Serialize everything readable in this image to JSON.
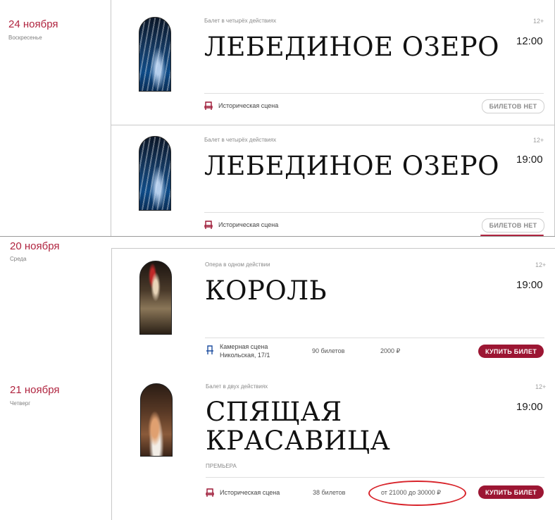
{
  "dates": [
    {
      "date": "24 ноября",
      "weekday": "Воскресенье"
    },
    {
      "date": "20 ноября",
      "weekday": "Среда"
    },
    {
      "date": "21 ноября",
      "weekday": "Четверг"
    }
  ],
  "events": [
    {
      "genre": "Балет в четырёх действиях",
      "age": "12+",
      "title": "ЛЕБЕДИНОЕ ОЗЕРО",
      "time": "12:00",
      "venue": "Историческая сцена",
      "button": "БИЛЕТОВ НЕТ"
    },
    {
      "genre": "Балет в четырёх действиях",
      "age": "12+",
      "title": "ЛЕБЕДИНОЕ ОЗЕРО",
      "time": "19:00",
      "venue": "Историческая сцена",
      "button": "БИЛЕТОВ НЕТ"
    },
    {
      "genre": "Опера в одном действии",
      "age": "12+",
      "title": "КОРОЛЬ",
      "time": "19:00",
      "venue": "Камерная сцена",
      "venue_address": "Никольская, 17/1",
      "tickets": "90 билетов",
      "price": "2000 ₽",
      "button": "КУПИТЬ БИЛЕТ"
    },
    {
      "genre": "Балет в двух действиях",
      "age": "12+",
      "title_line1": "СПЯЩАЯ",
      "title_line2": "КРАСАВИЦА",
      "badge": "ПРЕМЬЕРА",
      "time": "19:00",
      "venue": "Историческая сцена",
      "tickets": "38 билетов",
      "price": "от 21000 до 30000 ₽",
      "button": "КУПИТЬ БИЛЕТ"
    }
  ],
  "icons": {
    "theatre_seat": "seat-icon",
    "chamber_seat": "chair-icon"
  },
  "colors": {
    "accent": "#9c1633",
    "date": "#b0243f",
    "annotation": "#d8232a"
  }
}
